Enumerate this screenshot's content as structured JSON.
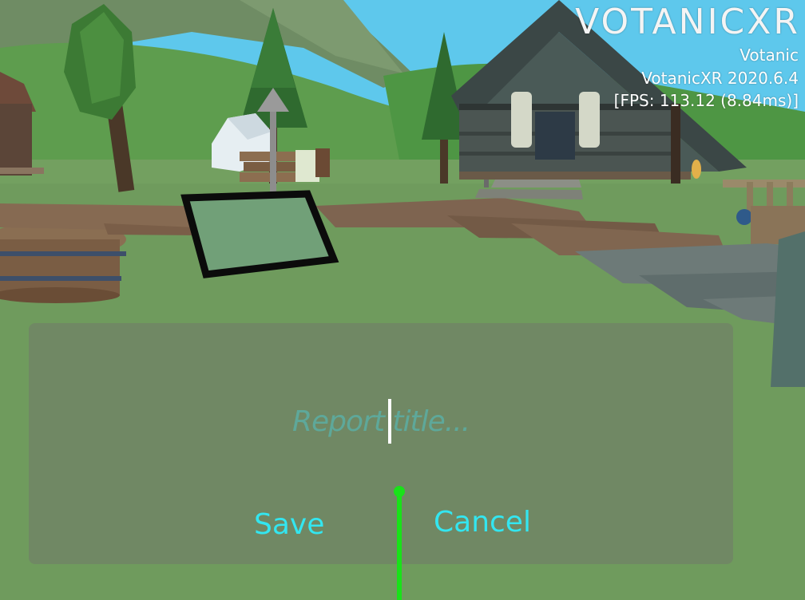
{
  "hud": {
    "logo_text": "VOTANICXR",
    "app_name": "Votanic",
    "app_version": "VotanicXR 2020.6.4",
    "fps": "[FPS: 113.12 (8.84ms)]"
  },
  "report_dialog": {
    "title_placeholder": "Report title...",
    "save_label": "Save",
    "cancel_label": "Cancel"
  },
  "colors": {
    "button_text": "#33e6f0",
    "placeholder_text": "#52bebe",
    "pointer_ray": "#19e219",
    "panel_bg": "#708465"
  }
}
